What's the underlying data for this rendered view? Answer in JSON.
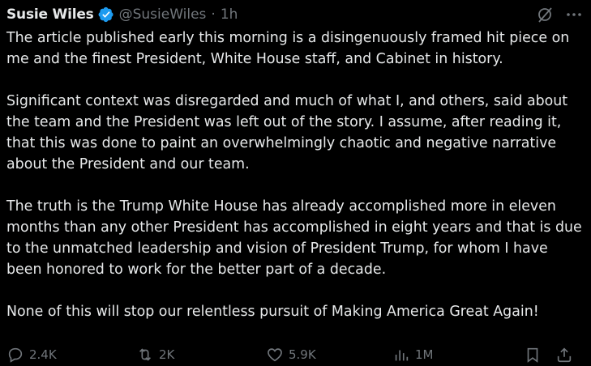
{
  "post": {
    "author_name": "Susie Wiles",
    "handle": "@SusieWiles",
    "separator": "·",
    "time": "1h",
    "text": "The article published early this morning is a disingenuously framed hit piece on me and the finest President, White House staff, and Cabinet in history.\n\nSignificant context was disregarded and much of what I, and others, said about the team and the President was left out of the story. I assume, after reading it, that this was done to paint an overwhelmingly chaotic and negative narrative about the President and our team.\n\nThe truth is the Trump White House has already accomplished more in eleven months than any other President has accomplished in eight years and that is due to the unmatched leadership and vision of President Trump, for whom I have been honored to work for the better part of a decade.\n\nNone of this will stop our relentless pursuit of Making America Great Again!"
  },
  "actions": {
    "replies": "2.4K",
    "reposts": "2K",
    "likes": "5.9K",
    "views": "1M"
  },
  "icons": {
    "verified": "verified-badge-icon",
    "grok": "grok-icon",
    "more": "more-icon",
    "reply": "reply-icon",
    "repost": "repost-icon",
    "like": "heart-icon",
    "views": "views-icon",
    "bookmark": "bookmark-icon",
    "share": "share-icon"
  },
  "colors": {
    "background": "#000000",
    "text": "#e7e9ea",
    "muted": "#71767b",
    "verified": "#1d9bf0"
  }
}
